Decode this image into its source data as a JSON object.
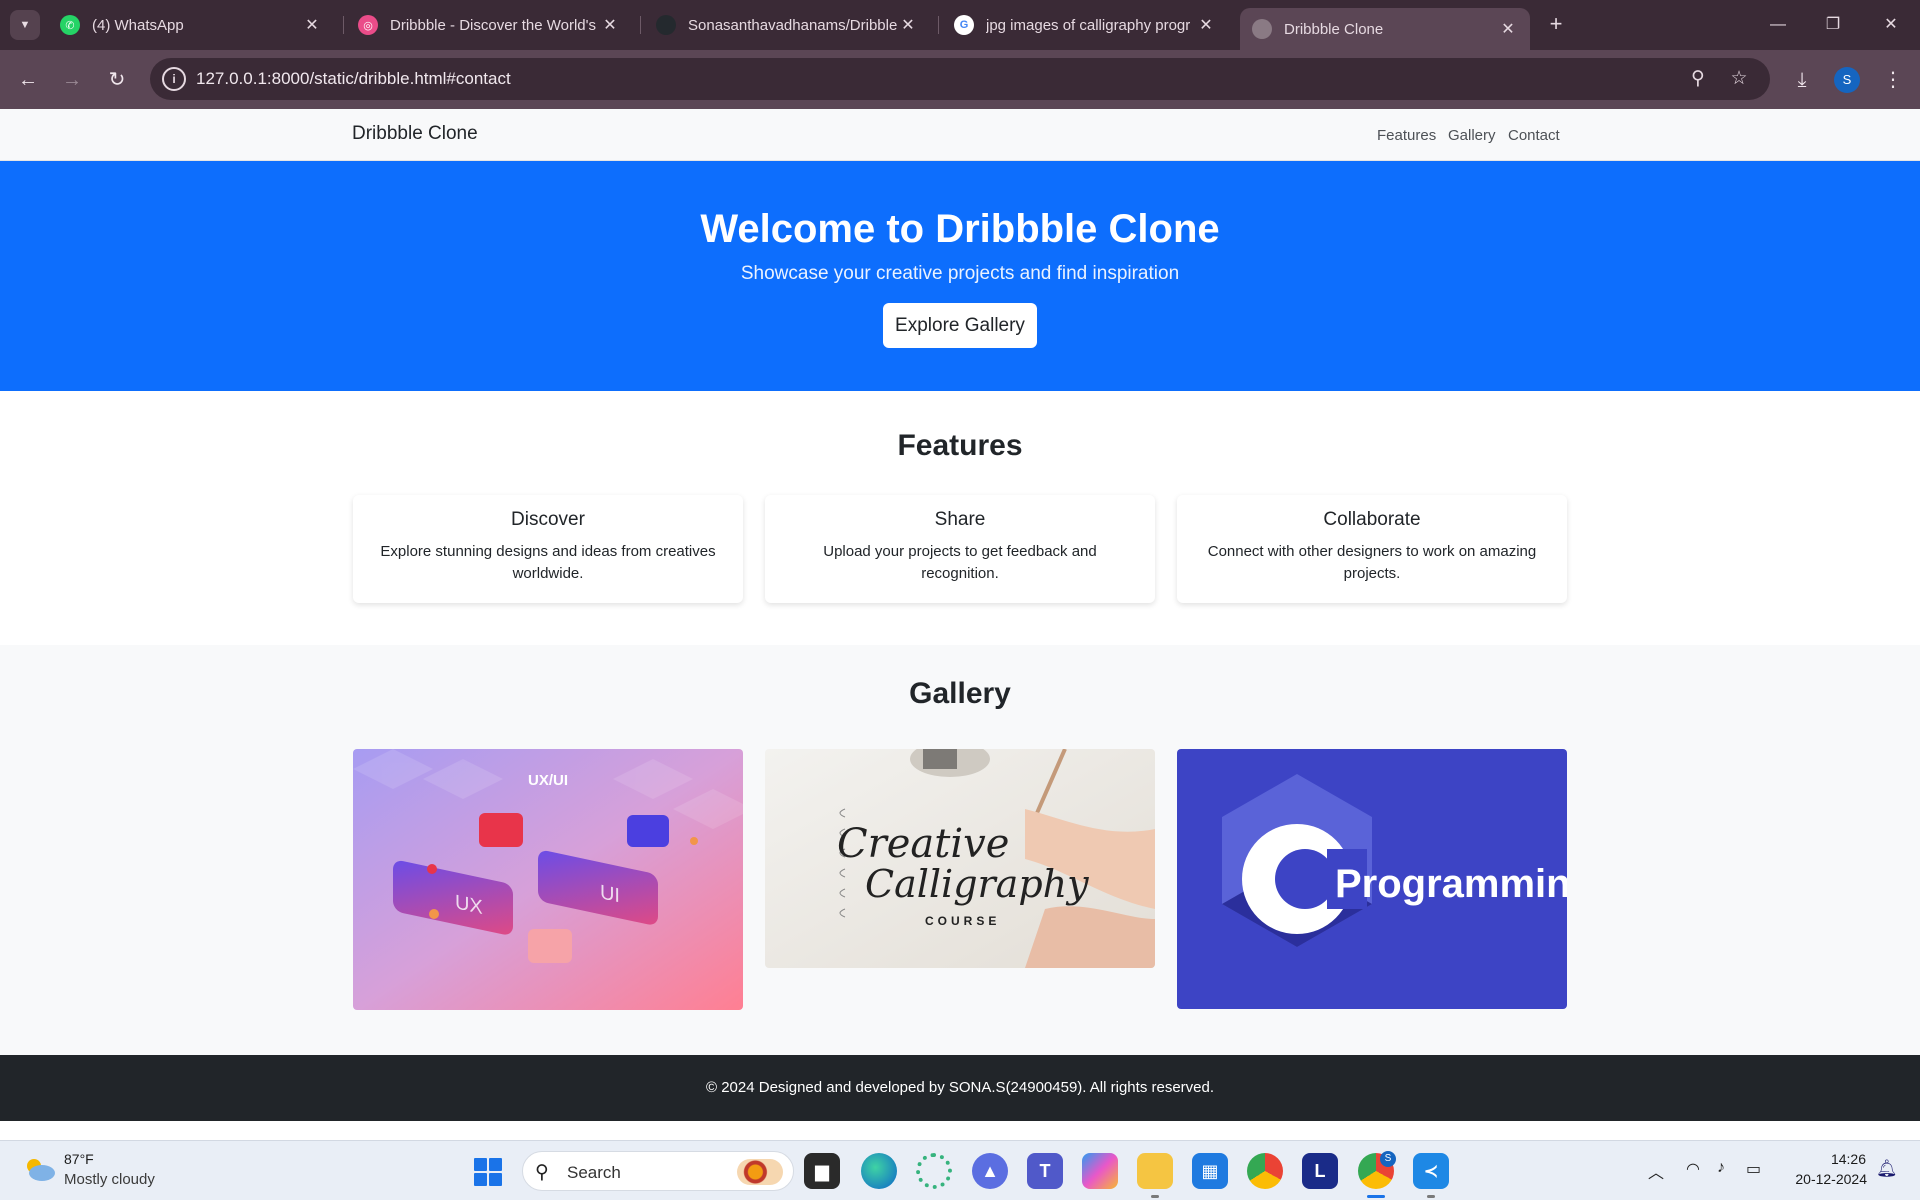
{
  "browser": {
    "tabs": [
      {
        "title": "(4) WhatsApp",
        "icon": "whatsapp-icon",
        "color": "#25d366",
        "active": false
      },
      {
        "title": "Dribbble - Discover the World's",
        "icon": "dribbble-icon",
        "color": "#ea4c89",
        "active": false
      },
      {
        "title": "Sonasanthavadhanams/Dribble",
        "icon": "github-icon",
        "color": "#24292e",
        "active": false
      },
      {
        "title": "jpg images of calligraphy progr",
        "icon": "google-icon",
        "color": "#4285f4",
        "active": false
      },
      {
        "title": "Dribbble Clone",
        "icon": "globe-icon",
        "color": "#8a7a84",
        "active": true
      }
    ],
    "url": "127.0.0.1:8000/static/dribble.html#contact",
    "profile_initial": "S"
  },
  "site": {
    "brand": "Dribbble Clone",
    "nav": [
      "Features",
      "Gallery",
      "Contact"
    ],
    "hero": {
      "title": "Welcome to Dribbble Clone",
      "subtitle": "Showcase your creative projects and find inspiration",
      "button": "Explore Gallery"
    },
    "features": {
      "title": "Features",
      "cards": [
        {
          "title": "Discover",
          "text": "Explore stunning designs and ideas from creatives worldwide."
        },
        {
          "title": "Share",
          "text": "Upload your projects to get feedback and recognition."
        },
        {
          "title": "Collaborate",
          "text": "Connect with other designers to work on amazing projects."
        }
      ]
    },
    "gallery": {
      "title": "Gallery",
      "images": [
        {
          "caption": "UX/UI",
          "caption_small": "UX",
          "caption_small2": "UI"
        },
        {
          "caption_line1": "Creative",
          "caption_line2": "Calligraphy",
          "caption_line3": "COURSE"
        },
        {
          "letter": "C",
          "caption": "Programming"
        }
      ]
    },
    "footer": "© 2024 Designed and developed by SONA.S(24900459). All rights reserved.",
    "accent": "#0d6efd"
  },
  "taskbar": {
    "weather_temp": "87°F",
    "weather_desc": "Mostly cloudy",
    "search_label": "Search",
    "time": "14:26",
    "date": "20-12-2024",
    "apps": [
      "file-explorer-dark-icon",
      "edge-icon",
      "app-green-icon",
      "app-triangle-icon",
      "teams-icon",
      "copilot-icon",
      "folder-icon",
      "store-icon",
      "chrome-icon",
      "l-app-icon",
      "chrome-profile-icon",
      "vscode-icon"
    ],
    "l_app_letter": "L",
    "chrome_profile_badge": "S"
  }
}
